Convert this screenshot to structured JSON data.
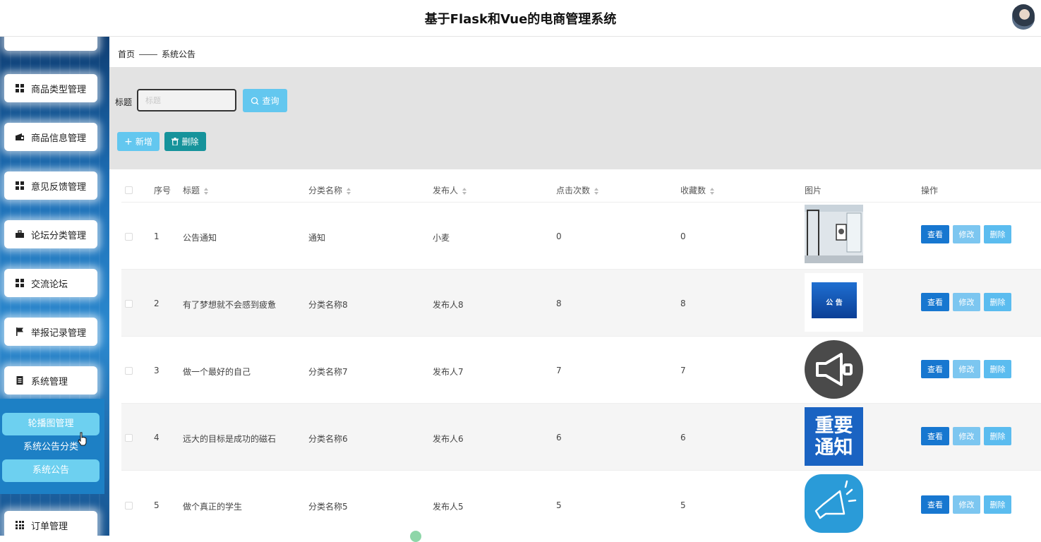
{
  "header": {
    "title": "基于Flask和Vue的电商管理系统",
    "avatar_icon": "user-avatar"
  },
  "sidebar": {
    "items": [
      {
        "label": "商品类型管理",
        "icon": "grid-icon"
      },
      {
        "label": "商品信息管理",
        "icon": "wallet-icon"
      },
      {
        "label": "意见反馈管理",
        "icon": "grid-icon"
      },
      {
        "label": "论坛分类管理",
        "icon": "briefcase-icon"
      },
      {
        "label": "交流论坛",
        "icon": "grid-icon"
      },
      {
        "label": "举报记录管理",
        "icon": "flag-icon"
      },
      {
        "label": "系统管理",
        "icon": "document-icon"
      },
      {
        "label": "订单管理",
        "icon": "grid9-icon"
      }
    ],
    "sub_items": [
      {
        "label": "轮播图管理"
      },
      {
        "label": "系统公告分类"
      },
      {
        "label": "系统公告"
      }
    ]
  },
  "breadcrumb": {
    "home": "首页",
    "current": "系统公告"
  },
  "search": {
    "label": "标题",
    "placeholder": "标题",
    "value": "",
    "query_button": "查询"
  },
  "toolbar": {
    "add_label": "新增",
    "delete_label": "删除"
  },
  "table": {
    "headers": {
      "index": "序号",
      "title": "标题",
      "category": "分类名称",
      "publisher": "发布人",
      "clicks": "点击次数",
      "favorites": "收藏数",
      "image": "图片",
      "actions": "操作"
    },
    "actions": {
      "view": "查看",
      "edit": "修改",
      "delete": "删除"
    },
    "rows": [
      {
        "index": "1",
        "title": "公告通知",
        "category": "通知",
        "publisher": "小麦",
        "clicks": "0",
        "favorites": "0",
        "image": "room-photo"
      },
      {
        "index": "2",
        "title": "有了梦想就不会感到疲惫",
        "category": "分类名称8",
        "publisher": "发布人8",
        "clicks": "8",
        "favorites": "8",
        "image": "announcement-banner",
        "image_text": "公 告"
      },
      {
        "index": "3",
        "title": "做一个最好的自己",
        "category": "分类名称7",
        "publisher": "发布人7",
        "clicks": "7",
        "favorites": "7",
        "image": "megaphone-dark"
      },
      {
        "index": "4",
        "title": "远大的目标是成功的磁石",
        "category": "分类名称6",
        "publisher": "发布人6",
        "clicks": "6",
        "favorites": "6",
        "image": "important-notice",
        "image_text_line1": "重要",
        "image_text_line2": "通知"
      },
      {
        "index": "5",
        "title": "做个真正的学生",
        "category": "分类名称5",
        "publisher": "发布人5",
        "clicks": "5",
        "favorites": "5",
        "image": "megaphone-blue"
      }
    ]
  }
}
